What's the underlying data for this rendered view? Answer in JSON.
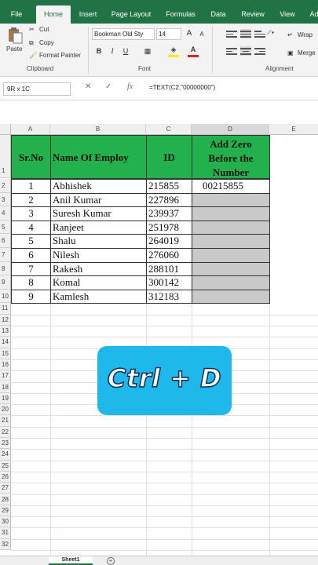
{
  "tabs": [
    "File",
    "Home",
    "Insert",
    "Page Layout",
    "Formulas",
    "Data",
    "Review",
    "View",
    "Ad"
  ],
  "clipboard": {
    "paste": "Paste",
    "cut": "Cut",
    "copy": "Copy",
    "format_painter": "Format Painter",
    "group_label": "Clipboard"
  },
  "font": {
    "name": "Bookman Old Sty",
    "size": "14",
    "grow": "A",
    "shrink": "A",
    "bold": "B",
    "italic": "I",
    "underline": "U",
    "group_label": "Font"
  },
  "alignment": {
    "wrap": "Wrap",
    "merge": "Merge",
    "group_label": "Alignment"
  },
  "formula_bar": {
    "name_box": "9R x 1C",
    "cancel": "✕",
    "enter": "✓",
    "fx": "fx",
    "formula": "=TEXT(C2,\"00000000\")"
  },
  "columns": [
    "A",
    "B",
    "C",
    "D",
    "E"
  ],
  "rows": [
    "1",
    "2",
    "3",
    "4",
    "5",
    "6",
    "7",
    "8",
    "9",
    "10",
    "11",
    "12",
    "13",
    "14",
    "15",
    "16",
    "17",
    "18",
    "19",
    "20",
    "21",
    "22",
    "23",
    "24",
    "25",
    "26",
    "27",
    "28",
    "29",
    "30",
    "31",
    "32"
  ],
  "table": {
    "headers": [
      "Sr.No",
      "Name Of Employ",
      "ID",
      "Add Zero Before the Number"
    ],
    "header_d_lines": [
      "Add Zero",
      "Before the",
      "Number"
    ],
    "rows": [
      {
        "sr": "1",
        "name": "Abhishek",
        "id": "215855",
        "result": "00215855"
      },
      {
        "sr": "2",
        "name": "Anil Kumar",
        "id": "227896",
        "result": ""
      },
      {
        "sr": "3",
        "name": "Suresh Kumar",
        "id": "239937",
        "result": ""
      },
      {
        "sr": "4",
        "name": "Ranjeet",
        "id": "251978",
        "result": ""
      },
      {
        "sr": "5",
        "name": "Shalu",
        "id": "264019",
        "result": ""
      },
      {
        "sr": "6",
        "name": "Nilesh",
        "id": "276060",
        "result": ""
      },
      {
        "sr": "7",
        "name": "Rakesh",
        "id": "288101",
        "result": ""
      },
      {
        "sr": "8",
        "name": "Komal",
        "id": "300142",
        "result": ""
      },
      {
        "sr": "9",
        "name": "Kamlesh",
        "id": "312183",
        "result": ""
      }
    ]
  },
  "overlay": {
    "text": "Ctrl + D"
  },
  "sheet": {
    "tab": "Sheet1",
    "add": "+"
  },
  "colors": {
    "excel_green": "#217346",
    "header_fill": "#22b14c",
    "selection_grey": "#c9c9c9",
    "badge_blue": "#1fb8ea"
  }
}
